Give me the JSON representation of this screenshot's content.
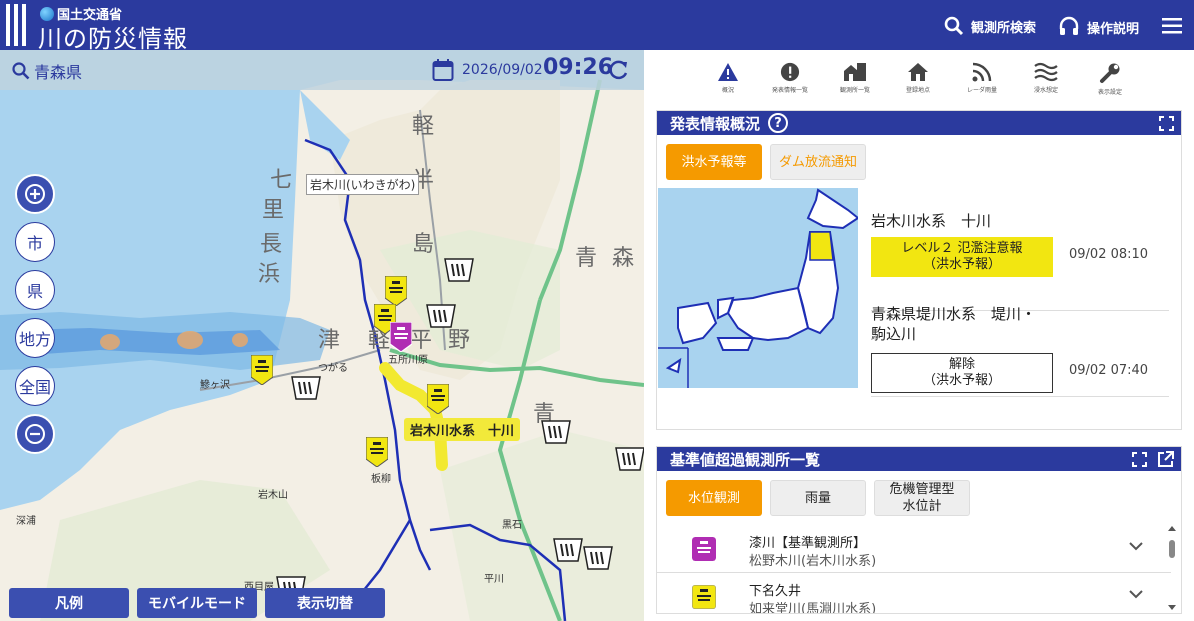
{
  "header": {
    "ministry": "国土交通省",
    "title": "川の防災情報",
    "search_label": "観測所検索",
    "help_label": "操作説明",
    "menu_icon": "hamburger-menu-icon"
  },
  "map_bar": {
    "search_text": "青森県",
    "date": "2026/09/02",
    "time": "09:26"
  },
  "map": {
    "zoom_buttons": [
      "市",
      "県",
      "地方",
      "全国"
    ],
    "river_label": "岩木川(いわきがわ)",
    "callout": "岩木川水系　十川",
    "place_names": [
      "軽",
      "半",
      "島",
      "七",
      "里",
      "長",
      "浜",
      "津",
      "軽",
      "平",
      "野",
      "青",
      "森",
      "青"
    ],
    "small_labels": [
      "五所川原",
      "つがる",
      "鰺ヶ沢",
      "岩木山",
      "深浦",
      "板柳",
      "黒石",
      "平川",
      "西目屋"
    ],
    "footer_buttons": [
      "凡例",
      "モバイルモード",
      "表示切替"
    ]
  },
  "toolbar": {
    "tools": [
      {
        "label": "概況",
        "icon": "warning-icon"
      },
      {
        "label": "発表情報一覧",
        "icon": "alert-icon"
      },
      {
        "label": "観測所一覧",
        "icon": "buildings-icon"
      },
      {
        "label": "登録地点",
        "icon": "home-icon"
      },
      {
        "label": "レーダ雨量",
        "icon": "radar-icon"
      },
      {
        "label": "浸水想定",
        "icon": "flood-icon"
      },
      {
        "label": "表示設定",
        "icon": "wrench-icon"
      }
    ]
  },
  "overview": {
    "title": "発表情報概況",
    "tabs": [
      "洪水予報等",
      "ダム放流通知"
    ],
    "events": [
      {
        "name": "岩木川水系　十川",
        "level": "レベル２ 氾濫注意報\n（洪水予報）",
        "time": "09/02 08:10",
        "color": "#f2e611"
      },
      {
        "name": "青森県堤川水系　堤川・\n駒込川",
        "level": "解除\n（洪水予報）",
        "time": "09/02 07:40",
        "color": "#ffffff"
      }
    ]
  },
  "stations": {
    "title": "基準値超過観測所一覧",
    "tabs": [
      "水位観測",
      "雨量",
      "危機管理型\n水位計"
    ],
    "rows": [
      {
        "name": "漆川【基準観測所】",
        "sub": "松野木川(岩木川水系)",
        "color": "#b02db3"
      },
      {
        "name": "下名久井",
        "sub": "如来堂川(馬淵川水系)",
        "color": "#f2e611"
      }
    ]
  }
}
